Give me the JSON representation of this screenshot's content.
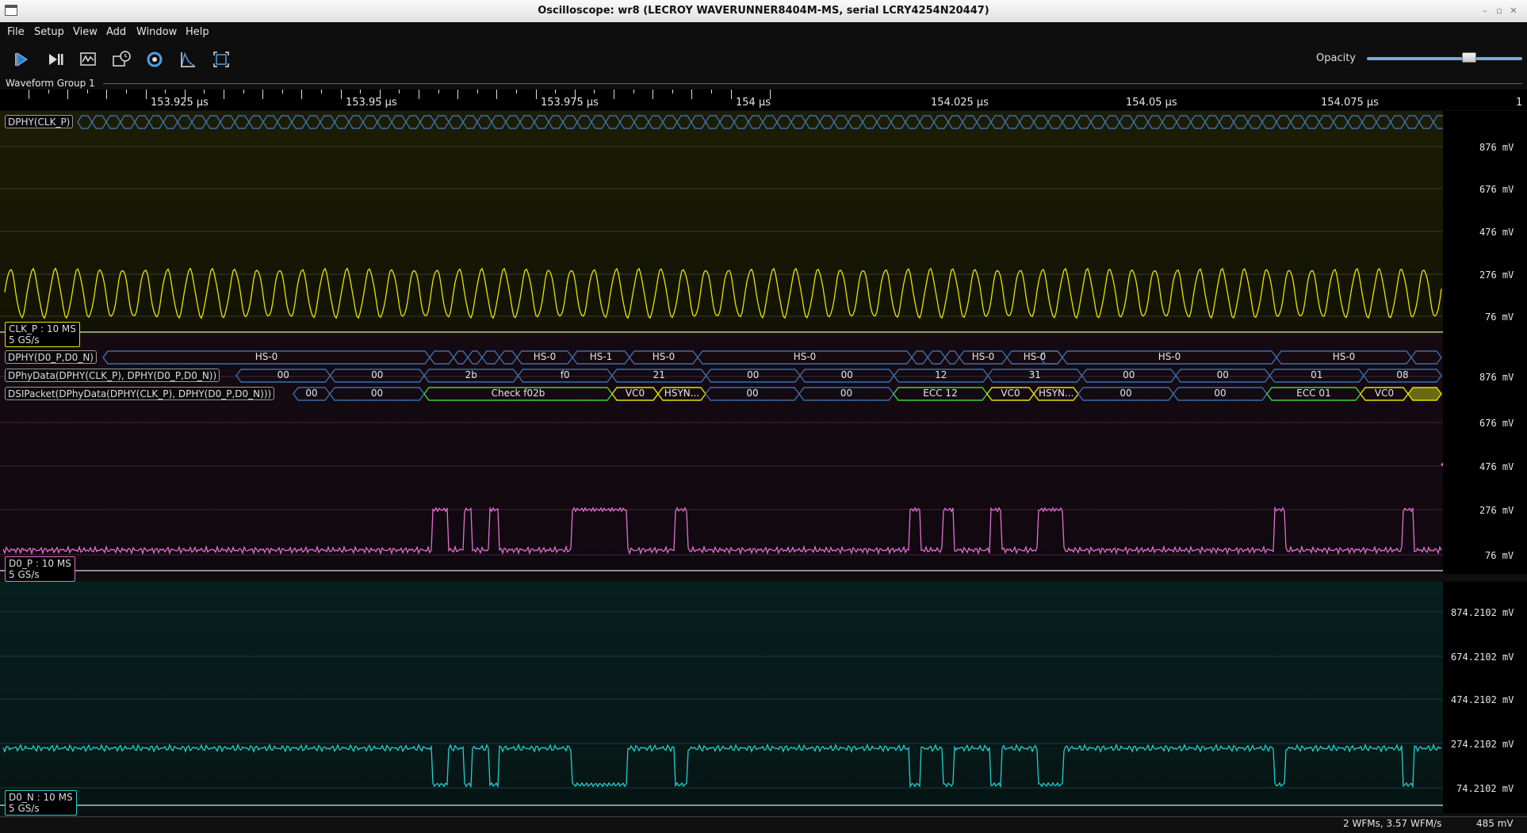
{
  "window": {
    "title": "Oscilloscope: wr8 (LECROY WAVERUNNER8404M-MS, serial LCRY4254N20447)"
  },
  "menu": [
    "File",
    "Setup",
    "View",
    "Add",
    "Window",
    "Help"
  ],
  "toolbar": {
    "buttons": [
      "start-icon",
      "single-trigger-icon",
      "auto-scale-icon",
      "history-icon",
      "refresh-icon",
      "measure-icon",
      "fullscreen-icon"
    ],
    "opacity_label": "Opacity",
    "opacity_value": 0.7
  },
  "waveform_group": {
    "label": "Waveform Group 1"
  },
  "timeline": {
    "labels": [
      "153.925 µs",
      "153.95 µs",
      "153.975 µs",
      "154 µs",
      "154.025 µs",
      "154.05 µs",
      "154.075 µs",
      "1"
    ]
  },
  "channels": {
    "clk": {
      "protocol_label": "DPHY(CLK_P)",
      "name_line1": "CLK_P : 10 MS",
      "name_line2": "5 GS/s",
      "color": "#e5e500",
      "axis": [
        "876  mV",
        "676  mV",
        "476  mV",
        "276  mV",
        "76  mV"
      ]
    },
    "d0p": {
      "name_line1": "D0_P : 10 MS",
      "name_line2": "5 GS/s",
      "color": "#e070d0",
      "axis": [
        "876  mV",
        "676  mV",
        "476  mV",
        "276  mV",
        "76  mV"
      ]
    },
    "d0n": {
      "name_line1": "D0_N : 10 MS",
      "name_line2": "5 GS/s",
      "color": "#20d0d0",
      "axis": [
        "874.2102  mV",
        "674.2102  mV",
        "474.2102  mV",
        "274.2102  mV",
        "74.2102  mV"
      ]
    }
  },
  "decodes": {
    "dphy": {
      "label": "DPHY(D0_P,D0_N)",
      "segments": [
        "HS-0",
        "HS-0",
        "HS-1",
        "HS-0",
        "HS-0",
        "HS-0",
        "HS-0",
        "HS-0",
        "HS-0"
      ]
    },
    "dphydata": {
      "label": "DPhyData(DPHY(CLK_P), DPHY(D0_P,D0_N))",
      "segments": [
        "00",
        "00",
        "2b",
        "f0",
        "21",
        "00",
        "00",
        "12",
        "31",
        "00",
        "00",
        "01",
        "08"
      ]
    },
    "dsipacket": {
      "label": "DSIPacket(DPhyData(DPHY(CLK_P), DPHY(D0_P,D0_N)))",
      "segments": [
        "00",
        "00",
        "Check f02b",
        "VC0",
        "HSYN...",
        "00",
        "00",
        "ECC 12",
        "VC0",
        "HSYN...",
        "00",
        "00",
        "ECC 01",
        "VC0",
        ""
      ]
    }
  },
  "status": {
    "wfms": "2 WFMs, 3.57 WFM/s",
    "cursor": "485 mV"
  },
  "colors": {
    "accent_blue": "#3d6ea8",
    "packet_green": "#3bd53b",
    "packet_yellow": "#e5e500"
  }
}
